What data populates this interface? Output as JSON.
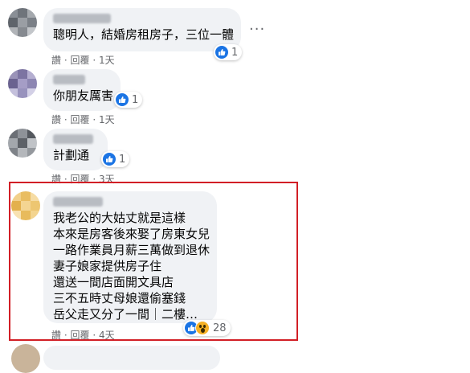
{
  "comments": [
    {
      "text": "聰明人，結婚房租房子，三位一體",
      "like_label": "讚",
      "reply_label": "回覆",
      "time": "1天",
      "reaction_count": "1"
    },
    {
      "text": "你朋友厲害",
      "like_label": "讚",
      "reply_label": "回覆",
      "time": "1天",
      "reaction_count": "1"
    },
    {
      "text": "計劃通",
      "like_label": "讚",
      "reply_label": "回覆",
      "time": "3天",
      "reaction_count": "1"
    },
    {
      "lines": [
        "我老公的大姑丈就是這樣",
        "本來是房客後來娶了房東女兒",
        "一路作業員月薪三萬做到退休",
        "妻子娘家提供房子住",
        "還送一間店面開文具店",
        "三不五時丈母娘還偷塞錢",
        "岳父走又分了一間｜二樓…"
      ],
      "like_label": "讚",
      "reply_label": "回覆",
      "time": "4天",
      "reaction_count": "28"
    }
  ],
  "separator": "·",
  "more_icon": "···",
  "colors": {
    "bubble_bg": "#f0f2f5",
    "like_blue": "#1b74e4",
    "highlight_red": "#d21f26",
    "meta_gray": "#65676b"
  }
}
